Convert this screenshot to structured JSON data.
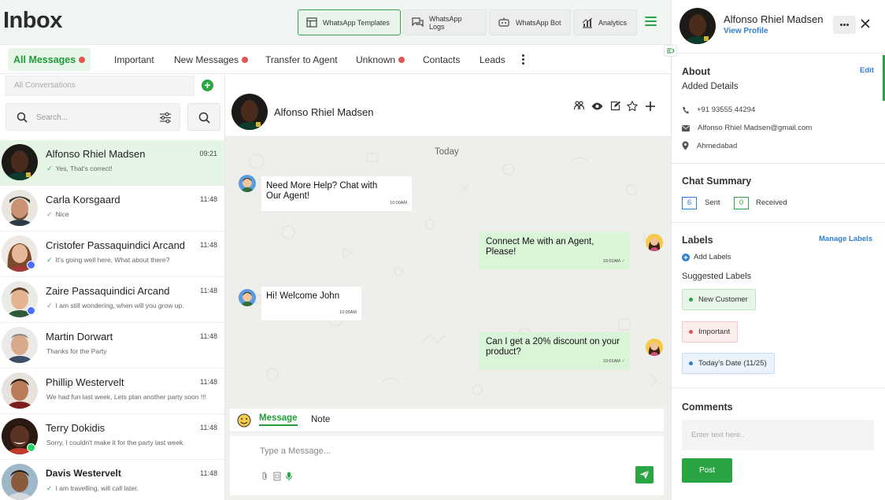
{
  "header": {
    "title": "Inbox",
    "buttons": [
      {
        "label": "WhatsApp Templates",
        "icon": "templates-icon",
        "active": true
      },
      {
        "label": "WhatsApp Logs",
        "icon": "chat-logs-icon",
        "active": false
      },
      {
        "label": "WhatsApp Bot",
        "icon": "bot-icon",
        "active": false
      },
      {
        "label": "Analytics",
        "icon": "analytics-icon",
        "active": false
      }
    ],
    "menu_icon": "hamburger-menu-icon"
  },
  "tabs": [
    {
      "label": "All Messages",
      "active": true,
      "badge": true
    },
    {
      "label": "Important",
      "active": false,
      "badge": false
    },
    {
      "label": "New Messages",
      "active": false,
      "badge": true
    },
    {
      "label": "Transfer to Agent",
      "active": false,
      "badge": false
    },
    {
      "label": "Unknown",
      "active": false,
      "badge": true
    },
    {
      "label": "Contacts",
      "active": false,
      "badge": false
    },
    {
      "label": "Leads",
      "active": false,
      "badge": false
    }
  ],
  "sidebar": {
    "conversation_filter": "All Conversations",
    "search_placeholder": "Search..."
  },
  "conversations": [
    {
      "name": "Alfonso Rhiel Madsen",
      "time": "09:21",
      "preview": "Yes, That's correct!",
      "read": true,
      "active": true,
      "platform": null
    },
    {
      "name": "Carla Korsgaard",
      "time": "11:48",
      "preview": "Nice",
      "read": true,
      "active": false,
      "platform": null
    },
    {
      "name": "Cristofer Passaquindici Arcand",
      "time": "11:48",
      "preview": "It's going well here, What about there?",
      "read": true,
      "active": false,
      "platform": "messenger"
    },
    {
      "name": "Zaire Passaquindici Arcand",
      "time": "11:48",
      "preview": "I am still wondering, when will you grow up.",
      "read": true,
      "active": false,
      "platform": "messenger"
    },
    {
      "name": "Martin Dorwart",
      "time": "11:48",
      "preview": "Thanks for the Party",
      "read": false,
      "active": false,
      "platform": null
    },
    {
      "name": "Phillip Westervelt",
      "time": "11:48",
      "preview": "We had fun last week, Lets plan another party soon !!!",
      "read": false,
      "active": false,
      "platform": null
    },
    {
      "name": "Terry Dokidis",
      "time": "11:48",
      "preview": "Sorry, I couldn't make it for the party last week.",
      "read": false,
      "active": false,
      "platform": "whatsapp"
    },
    {
      "name": "Davis Westervelt",
      "time": "11:48",
      "preview": "I am travelling, will call later.",
      "read": true,
      "active": false,
      "platform": null,
      "bold": true
    }
  ],
  "chat": {
    "contact_name": "Alfonso Rhiel Madsen",
    "header_icons": [
      "group-icon",
      "eye-icon",
      "edit-icon",
      "star-icon",
      "plus-icon"
    ],
    "day_label": "Today",
    "messages": [
      {
        "direction": "in",
        "text": "Need More Help? Chat with Our Agent!",
        "time": "10:00AM"
      },
      {
        "direction": "out",
        "text": "Connect Me with an Agent, Please!",
        "time": "10:01AM"
      },
      {
        "direction": "in",
        "text": "Hi! Welcome John",
        "time": "10:05AM"
      },
      {
        "direction": "out",
        "text": "Can I get a 20% discount on  your  product?",
        "time": "10:01AM"
      }
    ],
    "composer": {
      "tab_message": "Message",
      "tab_note": "Note",
      "placeholder": "Type a Message..."
    }
  },
  "profile": {
    "name": "Alfonso Rhiel Madsen",
    "view_link": "View Profile",
    "about_title": "About",
    "edit_link": "Edit",
    "added_details": "Added Details",
    "phone": "+91 93555 44294",
    "email": "Alfonso Rhiel Madsen@gmail.com",
    "location": "Ahmedabad",
    "chat_summary_title": "Chat Summary",
    "sent_count": "6",
    "sent_label": "Sent",
    "received_count": "0",
    "received_label": "Received",
    "labels_title": "Labels",
    "manage_labels": "Manage Labels",
    "add_labels": "Add Labels",
    "suggested_title": "Suggested Labels",
    "labels": [
      {
        "text": "New Customer",
        "dot": "#2aa543",
        "bg": "#e8f6ea",
        "border": "#bfe3c5"
      },
      {
        "text": "Important",
        "dot": "#e25555",
        "bg": "#fdeeee",
        "border": "#f3c9c9"
      },
      {
        "text": "Today's Date (11/25)",
        "dot": "#2f7fd0",
        "bg": "#eaf2fb",
        "border": "#c6dcf3"
      }
    ],
    "comments_title": "Comments",
    "comment_placeholder": "Enter text here..",
    "post_label": "Post"
  },
  "colors": {
    "accent": "#2aa543",
    "link": "#2f7fd0",
    "badge": "#e25555"
  }
}
